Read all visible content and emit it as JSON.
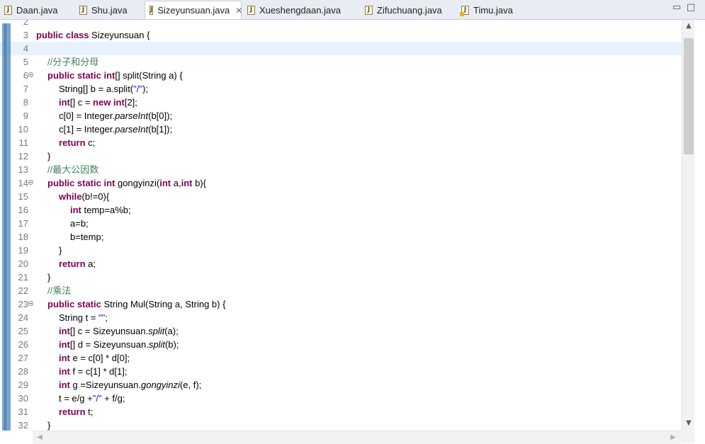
{
  "tabs": [
    {
      "label": "Daan.java",
      "active": false,
      "warning": false
    },
    {
      "label": "Shu.java",
      "active": false,
      "warning": false
    },
    {
      "label": "Sizeyunsuan.java",
      "active": true,
      "warning": false
    },
    {
      "label": "Xueshengdaan.java",
      "active": false,
      "warning": false
    },
    {
      "label": "Zifuchuang.java",
      "active": false,
      "warning": false
    },
    {
      "label": "Timu.java",
      "active": false,
      "warning": true
    }
  ],
  "window": {
    "minimize": "▭",
    "maximize": "□"
  },
  "editor": {
    "current_line": 4,
    "lines": [
      {
        "n": "2",
        "segs": []
      },
      {
        "n": "3",
        "indent": 0,
        "segs": [
          [
            "kw",
            "public class "
          ],
          [
            "",
            "Sizeyunsuan {"
          ]
        ]
      },
      {
        "n": "4",
        "indent": 0,
        "segs": []
      },
      {
        "n": "5",
        "indent": 1,
        "segs": [
          [
            "cm",
            "//分子和分母"
          ]
        ]
      },
      {
        "n": "6",
        "indent": 1,
        "fold": true,
        "segs": [
          [
            "kw",
            "public static int"
          ],
          [
            "",
            "[] split(String a) {"
          ]
        ]
      },
      {
        "n": "7",
        "indent": 2,
        "segs": [
          [
            "",
            "String[] b = a.split("
          ],
          [
            "st",
            "\"/\""
          ],
          [
            "",
            ");"
          ]
        ]
      },
      {
        "n": "8",
        "indent": 2,
        "segs": [
          [
            "kw",
            "int"
          ],
          [
            "",
            "[] c = "
          ],
          [
            "kw",
            "new int"
          ],
          [
            "",
            "[2];"
          ]
        ]
      },
      {
        "n": "9",
        "indent": 2,
        "segs": [
          [
            "",
            "c[0] = Integer."
          ],
          [
            "it",
            "parseInt"
          ],
          [
            "",
            "(b[0]);"
          ]
        ]
      },
      {
        "n": "10",
        "indent": 2,
        "segs": [
          [
            "",
            "c[1] = Integer."
          ],
          [
            "it",
            "parseInt"
          ],
          [
            "",
            "(b[1]);"
          ]
        ]
      },
      {
        "n": "11",
        "indent": 2,
        "segs": [
          [
            "kw",
            "return "
          ],
          [
            "",
            "c;"
          ]
        ]
      },
      {
        "n": "12",
        "indent": 1,
        "segs": [
          [
            "",
            "}"
          ]
        ]
      },
      {
        "n": "13",
        "indent": 1,
        "segs": [
          [
            "cm",
            "//最大公因数"
          ]
        ]
      },
      {
        "n": "14",
        "indent": 1,
        "fold": true,
        "segs": [
          [
            "kw",
            "public static int "
          ],
          [
            "",
            "gongyinzi("
          ],
          [
            "kw",
            "int "
          ],
          [
            "",
            "a,"
          ],
          [
            "kw",
            "int "
          ],
          [
            "",
            "b){"
          ]
        ]
      },
      {
        "n": "15",
        "indent": 2,
        "segs": [
          [
            "kw",
            "while"
          ],
          [
            "",
            "(b!=0){"
          ]
        ]
      },
      {
        "n": "16",
        "indent": 3,
        "segs": [
          [
            "kw",
            "int "
          ],
          [
            "",
            "temp=a%b;"
          ]
        ]
      },
      {
        "n": "17",
        "indent": 3,
        "segs": [
          [
            "",
            "a=b;"
          ]
        ]
      },
      {
        "n": "18",
        "indent": 3,
        "segs": [
          [
            "",
            "b=temp;"
          ]
        ]
      },
      {
        "n": "19",
        "indent": 2,
        "segs": [
          [
            "",
            "}"
          ]
        ]
      },
      {
        "n": "20",
        "indent": 2,
        "segs": [
          [
            "kw",
            "return "
          ],
          [
            "",
            "a;"
          ]
        ]
      },
      {
        "n": "21",
        "indent": 1,
        "segs": [
          [
            "",
            "}"
          ]
        ]
      },
      {
        "n": "22",
        "indent": 1,
        "segs": [
          [
            "cm",
            "//乘法"
          ]
        ]
      },
      {
        "n": "23",
        "indent": 1,
        "fold": true,
        "segs": [
          [
            "kw",
            "public static "
          ],
          [
            "",
            "String Mul(String a, String b) {"
          ]
        ]
      },
      {
        "n": "24",
        "indent": 2,
        "segs": [
          [
            "",
            "String t = "
          ],
          [
            "st",
            "\"\""
          ],
          [
            "",
            ";"
          ]
        ]
      },
      {
        "n": "25",
        "indent": 2,
        "segs": [
          [
            "kw",
            "int"
          ],
          [
            "",
            "[] c = Sizeyunsuan."
          ],
          [
            "it",
            "split"
          ],
          [
            "",
            "(a);"
          ]
        ]
      },
      {
        "n": "26",
        "indent": 2,
        "segs": [
          [
            "kw",
            "int"
          ],
          [
            "",
            "[] d = Sizeyunsuan."
          ],
          [
            "it",
            "split"
          ],
          [
            "",
            "(b);"
          ]
        ]
      },
      {
        "n": "27",
        "indent": 2,
        "segs": [
          [
            "kw",
            "int "
          ],
          [
            "",
            "e = c[0] * d[0];"
          ]
        ]
      },
      {
        "n": "28",
        "indent": 2,
        "segs": [
          [
            "kw",
            "int "
          ],
          [
            "",
            "f = c[1] * d[1];"
          ]
        ]
      },
      {
        "n": "29",
        "indent": 2,
        "segs": [
          [
            "kw",
            "int "
          ],
          [
            "",
            "g =Sizeyunsuan."
          ],
          [
            "it",
            "gongyinzi"
          ],
          [
            "",
            "(e, f);"
          ]
        ]
      },
      {
        "n": "30",
        "indent": 2,
        "segs": [
          [
            "",
            "t = e/g +"
          ],
          [
            "st",
            "\"/\""
          ],
          [
            "",
            " + f/g;"
          ]
        ]
      },
      {
        "n": "31",
        "indent": 2,
        "segs": [
          [
            "kw",
            "return "
          ],
          [
            "",
            "t;"
          ]
        ]
      },
      {
        "n": "32",
        "indent": 1,
        "segs": [
          [
            "",
            "}"
          ]
        ]
      }
    ]
  },
  "scroll": {
    "up": "▲",
    "down": "▼",
    "left": "◀",
    "right": "▶",
    "position": 0.06
  }
}
